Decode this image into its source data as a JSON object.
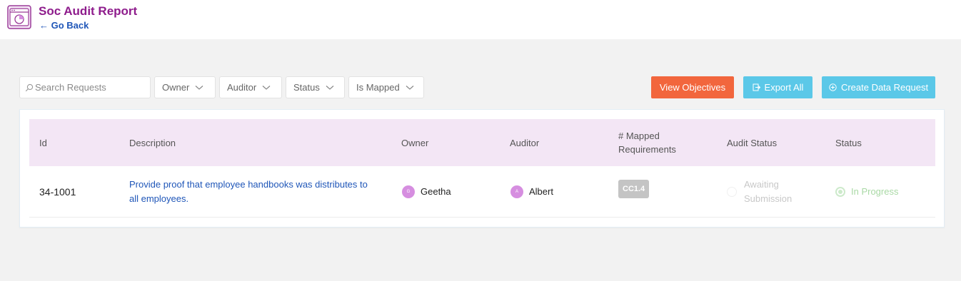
{
  "header": {
    "title": "Soc Audit Report",
    "go_back": "← Go Back",
    "logo_icon": "document-chart-icon"
  },
  "toolbar": {
    "search_placeholder": "Search Requests",
    "filters": [
      "Owner",
      "Auditor",
      "Status",
      "Is Mapped"
    ],
    "view_objectives": "View Objectives",
    "export_all": "Export All",
    "create_data_request": "Create Data Request"
  },
  "table": {
    "headers": {
      "id": "Id",
      "description": "Description",
      "owner": "Owner",
      "auditor": "Auditor",
      "mapped_line1": "# Mapped",
      "mapped_line2": "Requirements",
      "audit_status": "Audit Status",
      "status": "Status"
    },
    "rows": [
      {
        "id": "34-1001",
        "description_line1": "Provide proof that employee handbooks was distributes to",
        "description_line2": "all employees.",
        "owner_initial": "G",
        "owner": "Geetha",
        "auditor_initial": "A",
        "auditor": "Albert",
        "mapped": "CC1.4",
        "audit_status_line1": "Awaiting",
        "audit_status_line2": "Submission",
        "status": "In Progress"
      }
    ]
  },
  "colors": {
    "title": "#8e1c8c",
    "link": "#1f56b8",
    "orange_button": "#f2663d",
    "blue_button": "#5bc8e8",
    "table_header_bg": "#f3e6f5",
    "avatar": "#d68ee0",
    "tag": "#c4c4c4",
    "in_progress": "#a9d9a5"
  }
}
